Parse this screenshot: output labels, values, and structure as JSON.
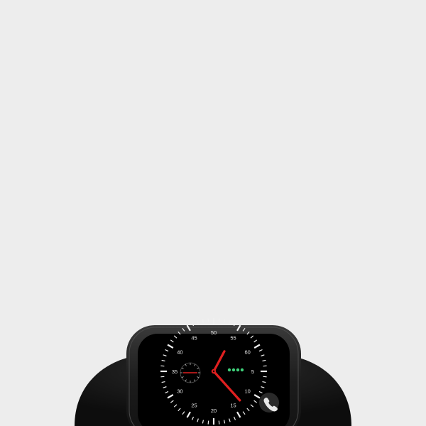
{
  "colors": {
    "background": "#ededed",
    "band": "#1a1a1a",
    "case": "#202020",
    "screen": "#000000",
    "hand_red": "#e02020",
    "hand_white": "#f2f2f2",
    "sub_dots": "#3fd07a"
  },
  "watch_face": {
    "outer_numbers": [
      "50",
      "55",
      "60",
      "5",
      "10",
      "15",
      "20",
      "25",
      "30",
      "35",
      "40",
      "45"
    ],
    "sub_dial_label": "",
    "complication_icon": "phone-icon"
  }
}
